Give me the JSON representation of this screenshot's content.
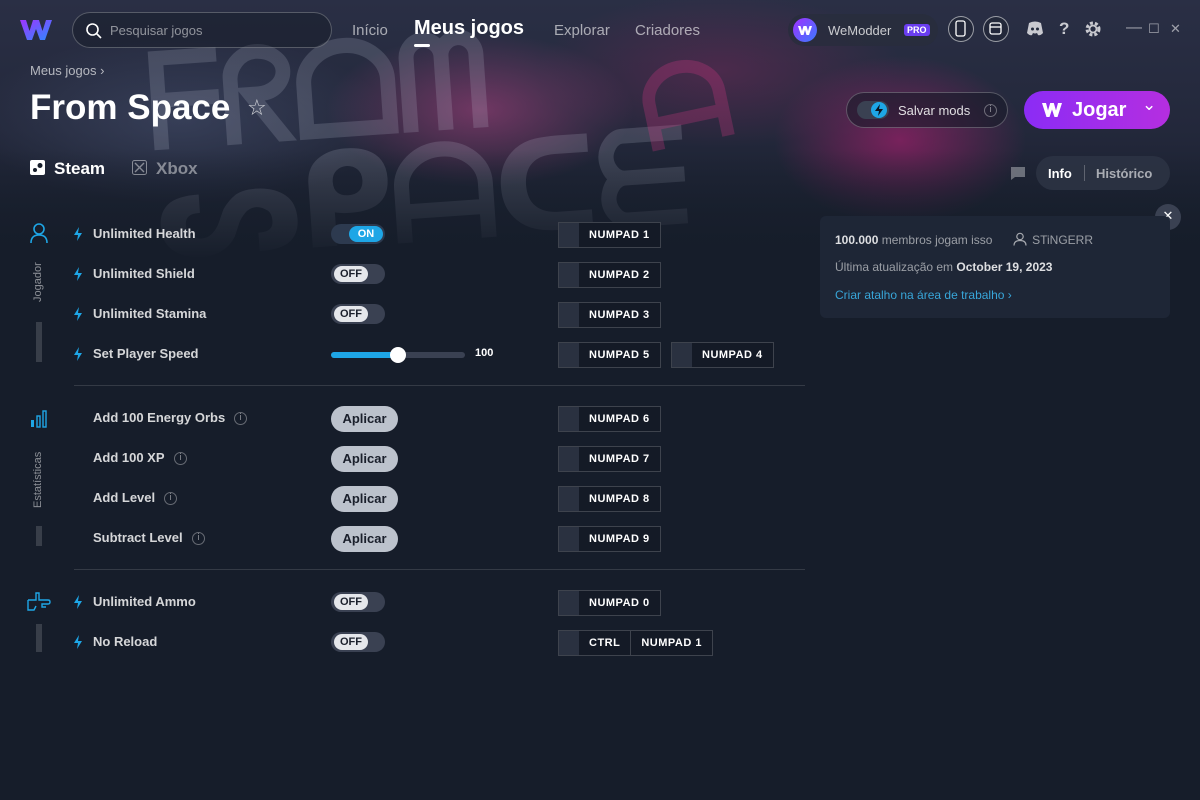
{
  "app": {
    "brand_color": "#8b2cf5",
    "accent": "#1ea6e6"
  },
  "search": {
    "placeholder": "Pesquisar jogos"
  },
  "nav": {
    "home": "Início",
    "my_games": "Meus jogos",
    "explore": "Explorar",
    "creators": "Criadores"
  },
  "user": {
    "name": "WeModder",
    "badge": "PRO"
  },
  "window_controls": {
    "minimize": "—",
    "maximize": "☐",
    "close": "✕"
  },
  "breadcrumb": {
    "label": "Meus jogos",
    "chevron": "›"
  },
  "game": {
    "title": "From Space"
  },
  "header_actions": {
    "save_mods": "Salvar mods",
    "play": "Jogar"
  },
  "platforms": [
    {
      "label": "Steam",
      "active": true
    },
    {
      "label": "Xbox",
      "active": false
    }
  ],
  "tabs": {
    "info": "Info",
    "history": "Histórico"
  },
  "categories": {
    "player": "Jogador",
    "stats": "Estatísticas"
  },
  "mods": [
    {
      "name": "Unlimited Health",
      "control": "toggle",
      "state": "ON",
      "keys": [
        [
          "NUMPAD 1"
        ]
      ]
    },
    {
      "name": "Unlimited Shield",
      "control": "toggle",
      "state": "OFF",
      "keys": [
        [
          "NUMPAD 2"
        ]
      ]
    },
    {
      "name": "Unlimited Stamina",
      "control": "toggle",
      "state": "OFF",
      "keys": [
        [
          "NUMPAD 3"
        ]
      ]
    },
    {
      "name": "Set Player Speed",
      "control": "slider",
      "value": "100",
      "fraction": 0.5,
      "keys": [
        [
          "NUMPAD 5"
        ],
        [
          "NUMPAD 4"
        ]
      ]
    },
    {
      "name": "Add 100 Energy Orbs",
      "control": "apply",
      "label": "Aplicar",
      "keys": [
        [
          "NUMPAD 6"
        ]
      ]
    },
    {
      "name": "Add 100 XP",
      "control": "apply",
      "label": "Aplicar",
      "keys": [
        [
          "NUMPAD 7"
        ]
      ]
    },
    {
      "name": "Add Level",
      "control": "apply",
      "label": "Aplicar",
      "keys": [
        [
          "NUMPAD 8"
        ]
      ]
    },
    {
      "name": "Subtract Level",
      "control": "apply",
      "label": "Aplicar",
      "keys": [
        [
          "NUMPAD 9"
        ]
      ]
    },
    {
      "name": "Unlimited Ammo",
      "control": "toggle",
      "state": "OFF",
      "keys": [
        [
          "NUMPAD 0"
        ]
      ]
    },
    {
      "name": "No Reload",
      "control": "toggle",
      "state": "OFF",
      "keys": [
        [
          "CTRL",
          "NUMPAD 1"
        ]
      ]
    }
  ],
  "info": {
    "members_count": "100.000",
    "members_text": "membros jogam isso",
    "creator": "STiNGERR",
    "updated_label": "Última atualização em",
    "updated_date": "October 19, 2023",
    "shortcut_link": "Criar atalho na área de trabalho",
    "link_chevron": "›"
  },
  "icons": {
    "info": "i",
    "star": "☆",
    "close": "✕",
    "chevron": "⌄"
  }
}
